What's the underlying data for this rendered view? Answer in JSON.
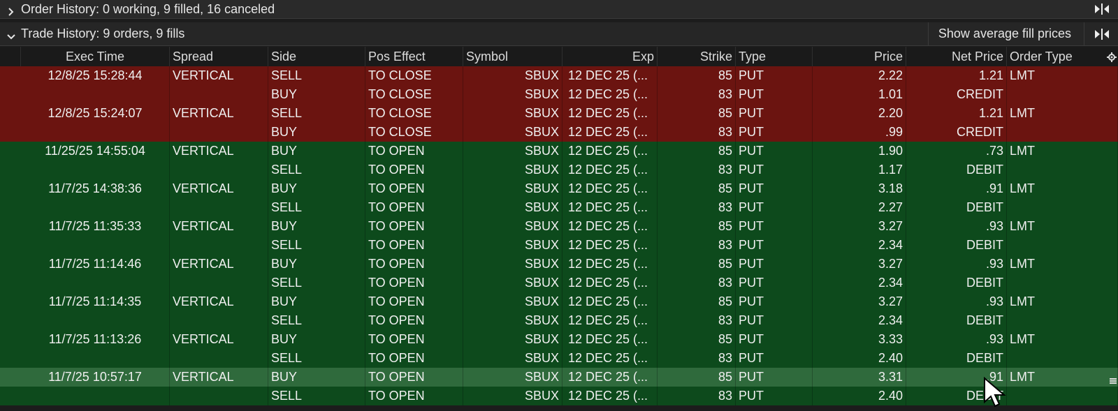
{
  "order_history": {
    "title": "Order History: 0 working, 9 filled, 16 canceled"
  },
  "trade_history": {
    "title": "Trade History: 9 orders, 9 fills",
    "avg_button": "Show average fill prices"
  },
  "columns": {
    "exec_time": "Exec Time",
    "spread": "Spread",
    "side": "Side",
    "pos_effect": "Pos Effect",
    "symbol": "Symbol",
    "exp": "Exp",
    "strike": "Strike",
    "type": "Type",
    "price": "Price",
    "net_price": "Net Price",
    "order_type": "Order Type"
  },
  "colors": {
    "canceled_row": "#6b1410",
    "filled_row": "#0d4a1c",
    "selected_row": "#2f6a3c"
  },
  "rows": [
    {
      "time": "12/8/25 15:28:44",
      "spread": "VERTICAL",
      "side": "SELL",
      "pos": "TO CLOSE",
      "symbol": "SBUX",
      "exp": "12 DEC 25 (...",
      "strike": "85",
      "type": "PUT",
      "price": "2.22",
      "net": "1.21",
      "otype": "LMT",
      "color": "red"
    },
    {
      "time": "",
      "spread": "",
      "side": "BUY",
      "pos": "TO CLOSE",
      "symbol": "SBUX",
      "exp": "12 DEC 25 (...",
      "strike": "83",
      "type": "PUT",
      "price": "1.01",
      "net": "CREDIT",
      "otype": "",
      "color": "red"
    },
    {
      "time": "12/8/25 15:24:07",
      "spread": "VERTICAL",
      "side": "SELL",
      "pos": "TO CLOSE",
      "symbol": "SBUX",
      "exp": "12 DEC 25 (...",
      "strike": "85",
      "type": "PUT",
      "price": "2.20",
      "net": "1.21",
      "otype": "LMT",
      "color": "red"
    },
    {
      "time": "",
      "spread": "",
      "side": "BUY",
      "pos": "TO CLOSE",
      "symbol": "SBUX",
      "exp": "12 DEC 25 (...",
      "strike": "83",
      "type": "PUT",
      "price": ".99",
      "net": "CREDIT",
      "otype": "",
      "color": "red"
    },
    {
      "time": "11/25/25 14:55:04",
      "spread": "VERTICAL",
      "side": "BUY",
      "pos": "TO OPEN",
      "symbol": "SBUX",
      "exp": "12 DEC 25 (...",
      "strike": "85",
      "type": "PUT",
      "price": "1.90",
      "net": ".73",
      "otype": "LMT",
      "color": "green"
    },
    {
      "time": "",
      "spread": "",
      "side": "SELL",
      "pos": "TO OPEN",
      "symbol": "SBUX",
      "exp": "12 DEC 25 (...",
      "strike": "83",
      "type": "PUT",
      "price": "1.17",
      "net": "DEBIT",
      "otype": "",
      "color": "green"
    },
    {
      "time": "11/7/25 14:38:36",
      "spread": "VERTICAL",
      "side": "BUY",
      "pos": "TO OPEN",
      "symbol": "SBUX",
      "exp": "12 DEC 25 (...",
      "strike": "85",
      "type": "PUT",
      "price": "3.18",
      "net": ".91",
      "otype": "LMT",
      "color": "green"
    },
    {
      "time": "",
      "spread": "",
      "side": "SELL",
      "pos": "TO OPEN",
      "symbol": "SBUX",
      "exp": "12 DEC 25 (...",
      "strike": "83",
      "type": "PUT",
      "price": "2.27",
      "net": "DEBIT",
      "otype": "",
      "color": "green"
    },
    {
      "time": "11/7/25 11:35:33",
      "spread": "VERTICAL",
      "side": "BUY",
      "pos": "TO OPEN",
      "symbol": "SBUX",
      "exp": "12 DEC 25 (...",
      "strike": "85",
      "type": "PUT",
      "price": "3.27",
      "net": ".93",
      "otype": "LMT",
      "color": "green"
    },
    {
      "time": "",
      "spread": "",
      "side": "SELL",
      "pos": "TO OPEN",
      "symbol": "SBUX",
      "exp": "12 DEC 25 (...",
      "strike": "83",
      "type": "PUT",
      "price": "2.34",
      "net": "DEBIT",
      "otype": "",
      "color": "green"
    },
    {
      "time": "11/7/25 11:14:46",
      "spread": "VERTICAL",
      "side": "BUY",
      "pos": "TO OPEN",
      "symbol": "SBUX",
      "exp": "12 DEC 25 (...",
      "strike": "85",
      "type": "PUT",
      "price": "3.27",
      "net": ".93",
      "otype": "LMT",
      "color": "green"
    },
    {
      "time": "",
      "spread": "",
      "side": "SELL",
      "pos": "TO OPEN",
      "symbol": "SBUX",
      "exp": "12 DEC 25 (...",
      "strike": "83",
      "type": "PUT",
      "price": "2.34",
      "net": "DEBIT",
      "otype": "",
      "color": "green"
    },
    {
      "time": "11/7/25 11:14:35",
      "spread": "VERTICAL",
      "side": "BUY",
      "pos": "TO OPEN",
      "symbol": "SBUX",
      "exp": "12 DEC 25 (...",
      "strike": "85",
      "type": "PUT",
      "price": "3.27",
      "net": ".93",
      "otype": "LMT",
      "color": "green"
    },
    {
      "time": "",
      "spread": "",
      "side": "SELL",
      "pos": "TO OPEN",
      "symbol": "SBUX",
      "exp": "12 DEC 25 (...",
      "strike": "83",
      "type": "PUT",
      "price": "2.34",
      "net": "DEBIT",
      "otype": "",
      "color": "green"
    },
    {
      "time": "11/7/25 11:13:26",
      "spread": "VERTICAL",
      "side": "BUY",
      "pos": "TO OPEN",
      "symbol": "SBUX",
      "exp": "12 DEC 25 (...",
      "strike": "85",
      "type": "PUT",
      "price": "3.33",
      "net": ".93",
      "otype": "LMT",
      "color": "green"
    },
    {
      "time": "",
      "spread": "",
      "side": "SELL",
      "pos": "TO OPEN",
      "symbol": "SBUX",
      "exp": "12 DEC 25 (...",
      "strike": "83",
      "type": "PUT",
      "price": "2.40",
      "net": "DEBIT",
      "otype": "",
      "color": "green"
    },
    {
      "time": "11/7/25 10:57:17",
      "spread": "VERTICAL",
      "side": "BUY",
      "pos": "TO OPEN",
      "symbol": "SBUX",
      "exp": "12 DEC 25 (...",
      "strike": "85",
      "type": "PUT",
      "price": "3.31",
      "net": ".91",
      "otype": "LMT",
      "color": "sel"
    },
    {
      "time": "",
      "spread": "",
      "side": "SELL",
      "pos": "TO OPEN",
      "symbol": "SBUX",
      "exp": "12 DEC 25 (...",
      "strike": "83",
      "type": "PUT",
      "price": "2.40",
      "net": "DEBIT",
      "otype": "",
      "color": "green"
    }
  ]
}
